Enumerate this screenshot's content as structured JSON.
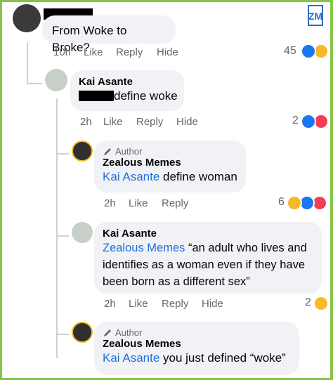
{
  "comments": [
    {
      "text": "From Woke to Broke?",
      "time": "10h",
      "like": "Like",
      "reply": "Reply",
      "hide": "Hide",
      "count": "45"
    },
    {
      "author": "Kai Asante",
      "text": "define woke",
      "time": "2h",
      "like": "Like",
      "reply": "Reply",
      "hide": "Hide",
      "count": "2"
    },
    {
      "badge": "Author",
      "author": "Zealous Memes",
      "mention": "Kai Asante",
      "text": " define woman",
      "time": "2h",
      "like": "Like",
      "reply": "Reply",
      "count": "6"
    },
    {
      "author": "Kai Asante",
      "mention": "Zealous Memes",
      "text": " “an adult who lives and identifies as a woman even if they have been born as a different sex”",
      "time": "2h",
      "like": "Like",
      "reply": "Reply",
      "hide": "Hide",
      "count": "2"
    },
    {
      "badge": "Author",
      "author": "Zealous Memes",
      "mention": "Kai Asante",
      "text": " you just defined “woke”"
    }
  ],
  "colors": {
    "like_blue": "#1877f2",
    "haha_yellow": "#f7b928",
    "love_red": "#f33e58",
    "link": "#216fdb",
    "frame_green": "#86c34a"
  },
  "icons": {
    "like": "like-reaction-icon",
    "haha": "haha-reaction-icon",
    "love": "love-reaction-icon",
    "pen": "pen-author-icon"
  }
}
